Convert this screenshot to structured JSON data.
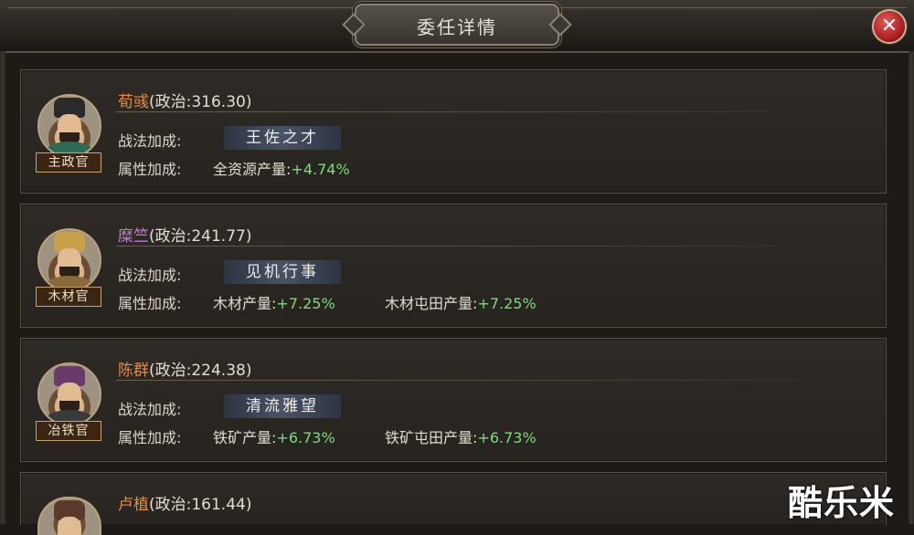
{
  "header": {
    "title": "委任详情",
    "close_icon": "close-icon"
  },
  "officials": [
    {
      "name": "荀彧",
      "politics": "(政治:316.30)",
      "role": "主政官",
      "skill_label": "战法加成:",
      "skill": "王佐之才",
      "attr_label": "属性加成:",
      "attrs": [
        {
          "name": "全资源产量:",
          "value": "+4.74%"
        }
      ]
    },
    {
      "name": "糜竺",
      "politics": "(政治:241.77)",
      "role": "木材官",
      "skill_label": "战法加成:",
      "skill": "见机行事",
      "attr_label": "属性加成:",
      "attrs": [
        {
          "name": "木材产量:",
          "value": "+7.25%"
        },
        {
          "name": "木材屯田产量:",
          "value": "+7.25%"
        }
      ]
    },
    {
      "name": "陈群",
      "politics": "(政治:224.38)",
      "role": "冶铁官",
      "skill_label": "战法加成:",
      "skill": "清流雅望",
      "attr_label": "属性加成:",
      "attrs": [
        {
          "name": "铁矿产量:",
          "value": "+6.73%"
        },
        {
          "name": "铁矿屯田产量:",
          "value": "+6.73%"
        }
      ]
    },
    {
      "name": "卢植",
      "politics": "(政治:161.44)"
    }
  ],
  "watermark": "酷乐米",
  "colors": {
    "name_orange": "#e48a45",
    "name_purple": "#c07ad2",
    "bonus_green": "#7ddc7a"
  }
}
